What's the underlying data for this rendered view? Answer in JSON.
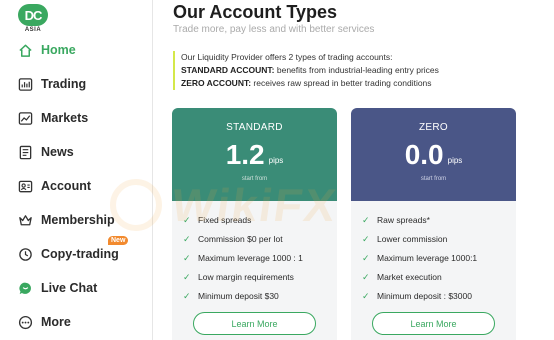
{
  "brand": {
    "mark": "DC",
    "sub": "ASIA"
  },
  "nav": [
    {
      "label": "Home",
      "icon": "home-icon"
    },
    {
      "label": "Trading",
      "icon": "trading-icon"
    },
    {
      "label": "Markets",
      "icon": "markets-icon"
    },
    {
      "label": "News",
      "icon": "news-icon"
    },
    {
      "label": "Account",
      "icon": "account-icon"
    },
    {
      "label": "Membership",
      "icon": "crown-icon"
    },
    {
      "label": "Copy-trading",
      "icon": "copy-trading-icon",
      "badge": "New"
    },
    {
      "label": "Live Chat",
      "icon": "chat-icon"
    },
    {
      "label": "More",
      "icon": "more-icon"
    }
  ],
  "page": {
    "title": "Our Account Types",
    "subtitle": "Trade more, pay less and with better services",
    "intro": "Our Liquidity Provider offers 2 types of trading accounts:",
    "standard_label": "STANDARD ACCOUNT:",
    "standard_desc": " benefits from industrial-leading entry prices",
    "zero_label": "ZERO ACCOUNT:",
    "zero_desc": " receives raw spread in better trading conditions"
  },
  "cards": {
    "standard": {
      "name": "STANDARD",
      "value": "1.2",
      "unit": "pips",
      "sub": "start from",
      "features": [
        "Fixed spreads",
        "Commission $0 per lot",
        "Maximum leverage 1000 : 1",
        "Low margin requirements",
        "Minimum deposit $30"
      ],
      "button": "Learn More"
    },
    "zero": {
      "name": "ZERO",
      "value": "0.0",
      "unit": "pips",
      "sub": "start from",
      "features": [
        "Raw spreads*",
        "Lower commission",
        "Maximum leverage 1000:1",
        "Market execution",
        "Minimum deposit : $3000"
      ],
      "button": "Learn More"
    }
  },
  "watermark": "WikiFX",
  "colors": {
    "accent": "#3aa860",
    "standard_head": "#3a8c77",
    "zero_head": "#4a5687",
    "badge": "#f28a2e"
  }
}
